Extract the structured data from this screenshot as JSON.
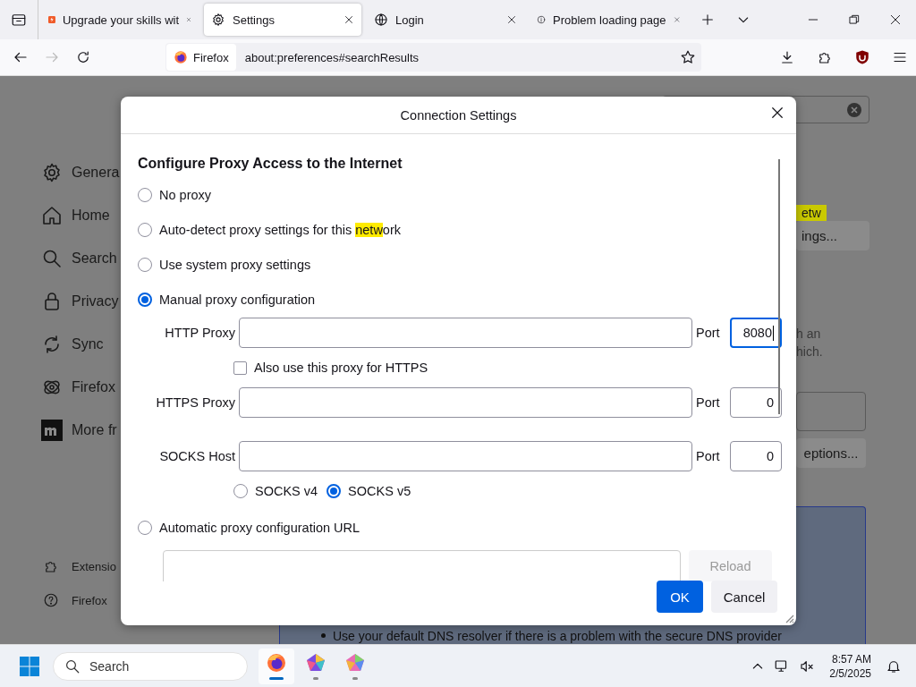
{
  "tabs": [
    {
      "title": "Upgrade your skills wit",
      "selected": false
    },
    {
      "title": "Settings",
      "selected": true
    },
    {
      "title": "Login",
      "selected": false
    },
    {
      "title": "Problem loading page",
      "selected": false
    }
  ],
  "toolbar": {
    "identity": "Firefox",
    "url": "about:preferences#searchResults"
  },
  "sidebar": {
    "items": [
      {
        "label": "Genera"
      },
      {
        "label": "Home"
      },
      {
        "label": "Search"
      },
      {
        "label": "Privacy"
      },
      {
        "label": "Sync"
      },
      {
        "label": "Firefox"
      },
      {
        "label": "More fr"
      }
    ],
    "footer": [
      {
        "label": "Extensio"
      },
      {
        "label": "Firefox"
      }
    ]
  },
  "background": {
    "highlight": "etw",
    "button_1": "ings...",
    "text_lines": [
      "h an",
      "hich."
    ],
    "button_2": "eptions...",
    "dns_note": "Use your default DNS resolver if there is a problem with the secure DNS provider"
  },
  "dialog": {
    "title": "Connection Settings",
    "heading": "Configure Proxy Access to the Internet",
    "proxy_modes": [
      {
        "label": "No proxy",
        "selected": false
      },
      {
        "label": "Auto-detect proxy settings for this ",
        "highlight": "netw",
        "label_end": "ork",
        "selected": false
      },
      {
        "label": "Use system proxy settings",
        "selected": false
      },
      {
        "label": "Manual proxy configuration",
        "selected": true
      }
    ],
    "proxies": [
      {
        "label": "HTTP Proxy",
        "port_label": "Port",
        "port": "8080",
        "focused": true
      },
      {
        "label": "HTTPS Proxy",
        "port_label": "Port",
        "port": "0",
        "focused": false
      },
      {
        "label": "SOCKS Host",
        "port_label": "Port",
        "port": "0",
        "focused": false
      }
    ],
    "https_checkbox": {
      "label": "Also use this proxy for HTTPS",
      "checked": false
    },
    "socks_versions": [
      {
        "label": "SOCKS v4",
        "selected": false
      },
      {
        "label": "SOCKS v5",
        "selected": true
      }
    ],
    "auto_config": {
      "label": "Automatic proxy configuration URL",
      "selected": false,
      "reload": "Reload",
      "reload_disabled": true
    },
    "buttons": [
      {
        "label": "OK",
        "kind": "primary"
      },
      {
        "label": "Cancel",
        "kind": "secondary"
      }
    ]
  },
  "taskbar": {
    "search": "Search",
    "apps": [
      {
        "active": true
      },
      {
        "active": false
      },
      {
        "active": false
      }
    ],
    "time": "8:57 AM",
    "date": "2/5/2025"
  }
}
